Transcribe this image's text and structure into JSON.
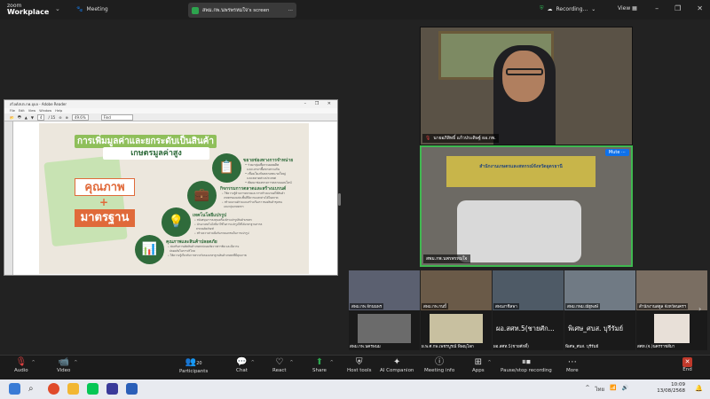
{
  "app": {
    "brand_top": "zoom",
    "brand_bottom": "Workplace",
    "meeting_label": "Meeting",
    "share_tab": "สพม.กพ.นพรพรหมใจ's screen",
    "recording": "Recording...",
    "view": "View"
  },
  "pdf": {
    "title": "สไลด์สปก.กพ.อุบล - Adobe Reader",
    "menu": "File Edit View Window Help",
    "page": "4",
    "total": "/ 15",
    "zoom": "49.6%",
    "find": "Find"
  },
  "slide": {
    "title_line1": "การเพิ่มมูลค่าและยกระดับเป็นสินค้า",
    "title_line2": "เกษตรมูลค่าสูง",
    "quality": "คุณภาพ",
    "plus": "+",
    "standard": "มาตรฐาน",
    "sections": [
      {
        "heading": "ขยายช่องทางการจำหน่าย",
        "body": "• ร่วมกลุ่มเพื่อรวมผลผลิต\n  และเจรจาซื้อขายรวมกัน\n• เชื่อมโยงกับตลาดขนาดใหญ่\n  และตลาดต่างประเทศ\n• พัฒนาช่องทางการตลาดออนไลน์"
      },
      {
        "heading": "กิจกรรมการตลาดและสร้างแบรนด์",
        "body": "• ใช้ความรู้ด้านการตลาดและการสร้างแบรนด์ให้สินค้า\n  เกษตรของแต่ละพื้นที่มีความแตกต่างได้ในตลาด\n• สร้างแบรนด์ร่วมและสร้างเรื่องราวของสินค้าชุมชน\n  และกลุ่มเกษตรกร"
      },
      {
        "heading": "เทคโนโลยีแปรรูป",
        "body": "• สนับสนุนการลงทุนเครื่องจักรแปรรูปสินค้าเกษตร\n• นำเอาเทคโนโลยีมาใช้ในการแปรรูปให้ได้มาตรฐานสากล\n  สากลผลิตภัณฑ์\n• สร้างความร่วมมือกับภาคเอกชนในการแปรรูป"
      },
      {
        "heading": "คุณภาพและสินค้าปลอดภัย",
        "body": "• ส่งเสริมการผลิตสินค้าเกษตรปลอดภัยจากสารพิษ และมีความ\n  ปลอดภัยในการบริโภค\n• ให้ความรู้เกี่ยวกับการตรวจรับรองมาตรฐานสินค้าเกษตรที่มีคุณภาพ"
      }
    ]
  },
  "speaker": {
    "name": "นายอภิสิทธิ์ แก้วประดิษฐ์ ผอ.กพ."
  },
  "room": {
    "banner": "สำนักงานเกษตรและสหกรณ์จังหวัดอุดรธานี",
    "name": "สพม.กพ.นพรพรหมใจ",
    "mute": "Mute"
  },
  "thumbs": [
    {
      "label": "สพม.กพ.จักนนพร"
    },
    {
      "label": "สพม.กพ.กนบี้"
    },
    {
      "label": "สพนงาชิลพา"
    },
    {
      "label": "สพม.กพม.ณัฐพงษ์"
    },
    {
      "label": "สำนักงานสตูล จังหวัดนครฯ"
    }
  ],
  "thumbs2": [
    {
      "big": "",
      "label": "สพม.กพ.นครพนม"
    },
    {
      "big": "",
      "label": "ผ.พ.ศ.กพ.เพชรบูรณ์ พิษณุโลก"
    },
    {
      "big": "ผอ.สศท.5(ชายศัก...",
      "label": "ผอ.สศท.5(ชายศักดิ์)"
    },
    {
      "big": "พิเศษ_ศบส. บุรีรัมย์",
      "label": "พิเศษ_ศบส. บุรีรัมย์"
    },
    {
      "big": "",
      "label": "สศท.(จ.)นครราชสีมา"
    }
  ],
  "toolbar": {
    "audio": "Audio",
    "video": "Video",
    "participants": "Participants",
    "participants_count": "20",
    "chat": "Chat",
    "react": "React",
    "share": "Share",
    "host_tools": "Host tools",
    "ai": "AI Companion",
    "meeting_info": "Meeting info",
    "apps": "Apps",
    "record": "Pause/stop recording",
    "more": "More",
    "end": "End"
  },
  "taskbar": {
    "lang": "ไทย",
    "time": "10:09",
    "date": "13/08/2568"
  },
  "colors": {
    "accent_green": "#2da44e",
    "zoom_blue": "#0e71eb",
    "slide_green": "#2f6b3b",
    "slide_orange": "#e06a3a"
  }
}
